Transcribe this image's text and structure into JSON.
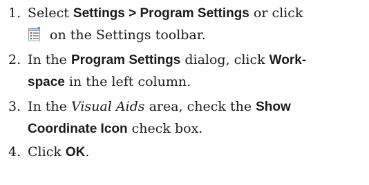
{
  "steps": [
    {
      "number": "1.",
      "line1_pre": "Select ",
      "line1_bold": "Settings > Program Settings",
      "line1_post": " or click",
      "line2_post": " on the Settings toolbar.",
      "icon": "program-settings-icon"
    },
    {
      "number": "2.",
      "line1_pre": "In the ",
      "line1_bold": "Program Settings",
      "line1_mid": " dialog, click ",
      "line1_bold2": "Work-",
      "line2_bold": "space",
      "line2_post": " in the left column."
    },
    {
      "number": "3.",
      "line1_pre": "In the ",
      "line1_italic": "Visual Aids",
      "line1_mid": " area, check the ",
      "line1_bold": "Show",
      "line2_bold": "Coordinate Icon",
      "line2_post": " check box."
    },
    {
      "number": "4.",
      "line1_pre": "Click ",
      "line1_bold": "OK",
      "line1_post": "."
    }
  ],
  "colors": {
    "text": "#1a1a1a",
    "icon_frame": "#8a9bb0",
    "icon_red": "#d83a2a",
    "icon_green": "#3f9a3a",
    "icon_blue": "#3a6fc4"
  }
}
